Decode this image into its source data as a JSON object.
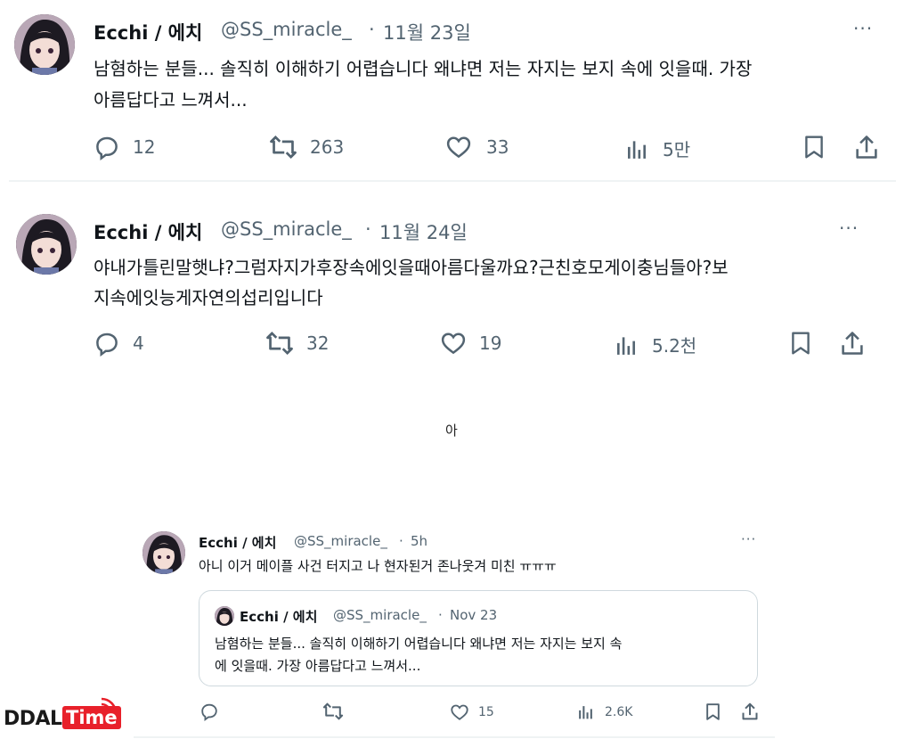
{
  "tweet1": {
    "name": "Ecchi / 에치",
    "handle": "@SS_miracle_",
    "dot": "·",
    "date": "11월 23일",
    "more": "···",
    "text_line1": "남혐하는 분들... 솔직히 이해하기 어렵습니다 왜냐면 저는 자지는 보지 속에 잇을때. 가장",
    "text_line2": "아름답다고 느껴서...",
    "replies": "12",
    "retweets": "263",
    "likes": "33",
    "views": "5만"
  },
  "tweet2": {
    "name": "Ecchi / 에치",
    "handle": "@SS_miracle_",
    "dot": "·",
    "date": "11월 24일",
    "more": "···",
    "text_line1": "야내가틀린말햇냐?그럼자지가후장속에잇을때아름다울까요?근친호모게이충님들아?보",
    "text_line2": "지속에잇능게자연의섭리입니다",
    "replies": "4",
    "retweets": "32",
    "likes": "19",
    "views": "5.2천"
  },
  "caption": "아",
  "tweet3": {
    "name": "Ecchi / 에치",
    "handle": "@SS_miracle_",
    "dot": "·",
    "time": "5h",
    "more": "···",
    "text": "아니 이거 메이플 사건 터지고 나 현자된거 존나웃겨 미친 ㅠㅠㅠ",
    "quote": {
      "name": "Ecchi / 에치",
      "handle": "@SS_miracle_",
      "dot": "·",
      "date": "Nov 23",
      "text_line1": "남혐하는 분들... 솔직히 이해하기 어렵습니다 왜냐면 저는 자지는 보지 속",
      "text_line2": "에 잇을때. 가장 아름답다고 느껴서..."
    },
    "replies": "",
    "retweets": "",
    "likes": "15",
    "views": "2.6K"
  },
  "watermark": {
    "part1": "DDAL",
    "part2": "Time"
  },
  "colors": {
    "text": "#0f1419",
    "secondary": "#536471",
    "divider": "#eff3f4",
    "watermark_red": "#e8202a",
    "watermark_dark": "#1a1a1a"
  }
}
